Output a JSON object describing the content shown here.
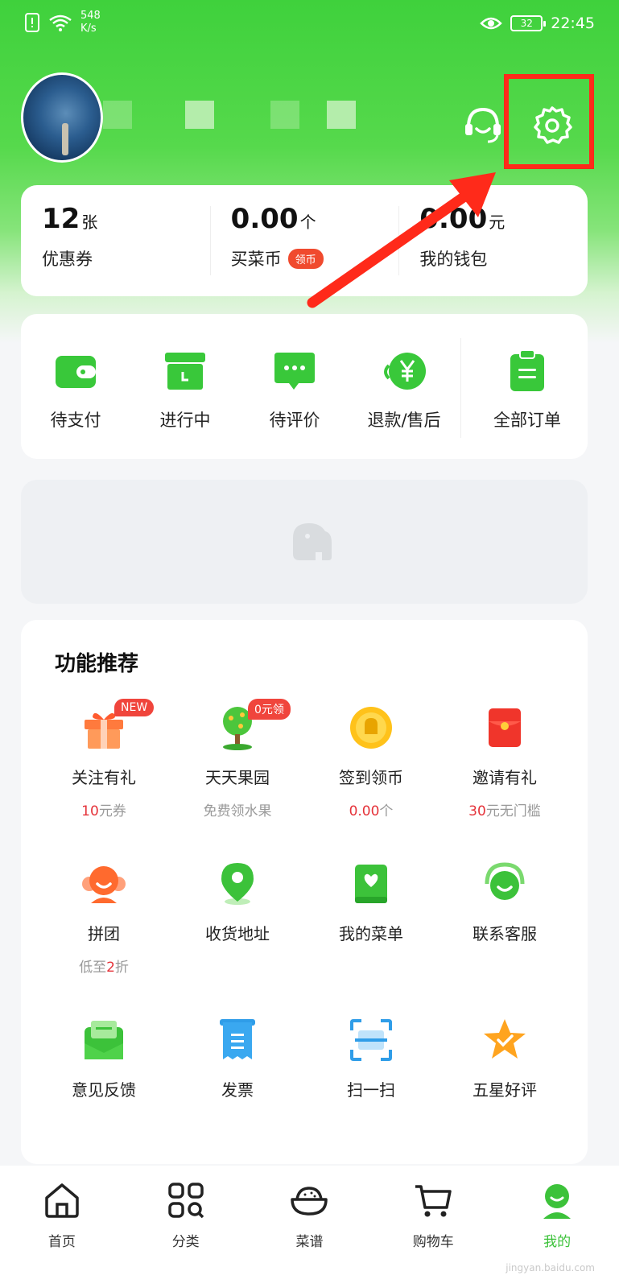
{
  "status_bar": {
    "speed_value": "548",
    "speed_unit": "K/s",
    "battery": "32",
    "time": "22:45"
  },
  "stats": [
    {
      "value": "12",
      "unit": "张",
      "label": "优惠券"
    },
    {
      "value": "0.00",
      "unit": "个",
      "label": "买菜币",
      "badge": "领币"
    },
    {
      "value": "0.00",
      "unit": "元",
      "label": "我的钱包"
    }
  ],
  "orders": [
    {
      "label": "待支付",
      "icon": "wallet-icon"
    },
    {
      "label": "进行中",
      "icon": "box-icon"
    },
    {
      "label": "待评价",
      "icon": "chat-icon"
    },
    {
      "label": "退款/售后",
      "icon": "refund-icon"
    },
    {
      "label": "全部订单",
      "icon": "clipboard-icon"
    }
  ],
  "features": {
    "title": "功能推荐",
    "items": [
      {
        "label": "关注有礼",
        "badge": "NEW",
        "sub_highlight": "10",
        "sub_rest": "元券",
        "icon": "gift-icon"
      },
      {
        "label": "天天果园",
        "badge": "0元领",
        "sub_highlight": "",
        "sub_rest": "免费领水果",
        "icon": "tree-icon"
      },
      {
        "label": "签到领币",
        "sub_highlight": "0.00",
        "sub_rest": "个",
        "icon": "coin-icon"
      },
      {
        "label": "邀请有礼",
        "sub_highlight": "30",
        "sub_rest": "元无门槛",
        "icon": "red-envelope-icon"
      },
      {
        "label": "拼团",
        "sub_prefix": "低至",
        "sub_highlight": "2",
        "sub_rest": "折",
        "icon": "group-icon"
      },
      {
        "label": "收货地址",
        "icon": "location-icon"
      },
      {
        "label": "我的菜单",
        "icon": "menu-book-icon"
      },
      {
        "label": "联系客服",
        "icon": "service-icon"
      },
      {
        "label": "意见反馈",
        "icon": "feedback-icon"
      },
      {
        "label": "发票",
        "icon": "invoice-icon"
      },
      {
        "label": "扫一扫",
        "icon": "scan-icon"
      },
      {
        "label": "五星好评",
        "icon": "star-icon"
      }
    ]
  },
  "nav": [
    {
      "label": "首页",
      "icon": "home-icon"
    },
    {
      "label": "分类",
      "icon": "category-icon"
    },
    {
      "label": "菜谱",
      "icon": "recipe-icon"
    },
    {
      "label": "购物车",
      "icon": "cart-icon"
    },
    {
      "label": "我的",
      "icon": "profile-icon",
      "active": true
    }
  ],
  "watermark": "jingyan.baidu.com",
  "colors": {
    "brand_green": "#3cc23a",
    "highlight_red": "#ff2a1a"
  }
}
